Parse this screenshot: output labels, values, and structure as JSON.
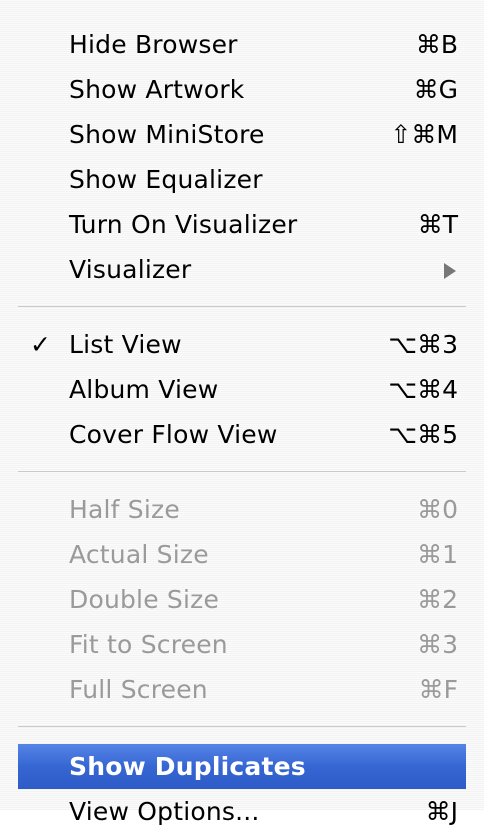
{
  "menu": {
    "groups": [
      {
        "items": [
          {
            "label": "Hide Browser",
            "shortcut": "⌘B",
            "enabled": true
          },
          {
            "label": "Show Artwork",
            "shortcut": "⌘G",
            "enabled": true
          },
          {
            "label": "Show MiniStore",
            "shortcut": "⇧⌘M",
            "enabled": true
          },
          {
            "label": "Show Equalizer",
            "shortcut": "",
            "enabled": true
          },
          {
            "label": "Turn On Visualizer",
            "shortcut": "⌘T",
            "enabled": true
          },
          {
            "label": "Visualizer",
            "shortcut": "",
            "submenu_icon": "submenu-arrow-icon",
            "enabled": true
          }
        ]
      },
      {
        "items": [
          {
            "label": "List View",
            "shortcut": "⌥⌘3",
            "checked": true,
            "check_glyph": "✓",
            "enabled": true
          },
          {
            "label": "Album View",
            "shortcut": "⌥⌘4",
            "enabled": true
          },
          {
            "label": "Cover Flow View",
            "shortcut": "⌥⌘5",
            "enabled": true
          }
        ]
      },
      {
        "items": [
          {
            "label": "Half Size",
            "shortcut": "⌘0",
            "enabled": false
          },
          {
            "label": "Actual Size",
            "shortcut": "⌘1",
            "enabled": false
          },
          {
            "label": "Double Size",
            "shortcut": "⌘2",
            "enabled": false
          },
          {
            "label": "Fit to Screen",
            "shortcut": "⌘3",
            "enabled": false
          },
          {
            "label": "Full Screen",
            "shortcut": "⌘F",
            "enabled": false
          }
        ]
      },
      {
        "items": [
          {
            "label": "Show Duplicates",
            "shortcut": "",
            "highlighted": true,
            "enabled": true
          },
          {
            "label": "View Options...",
            "shortcut": "⌘J",
            "enabled": true
          }
        ]
      }
    ],
    "colors": {
      "highlight": "#3a6ad4",
      "disabled_text": "#9a9a9a",
      "background": "#f7f7f7"
    }
  }
}
